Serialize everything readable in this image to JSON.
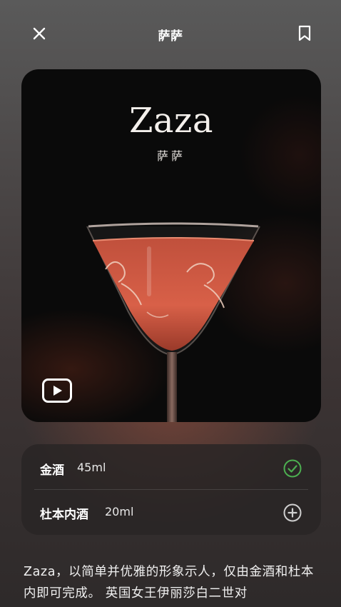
{
  "header": {
    "title": "萨萨",
    "close_icon": "close-icon",
    "bookmark_icon": "bookmark-icon"
  },
  "hero": {
    "name": "Zaza",
    "subtitle": "萨萨",
    "play_icon": "play-icon"
  },
  "ingredients": [
    {
      "name": "金酒",
      "amount": "45ml",
      "status_icon": "check-circle-icon",
      "status_color": "#4caf50"
    },
    {
      "name": "杜本内酒",
      "amount": "20ml",
      "status_icon": "add-circle-icon",
      "status_color": "#cfcfcf"
    }
  ],
  "description": "Zaza，以简单并优雅的形象示人，仅由金酒和杜本内即可完成。 英国女王伊丽莎白二世对"
}
